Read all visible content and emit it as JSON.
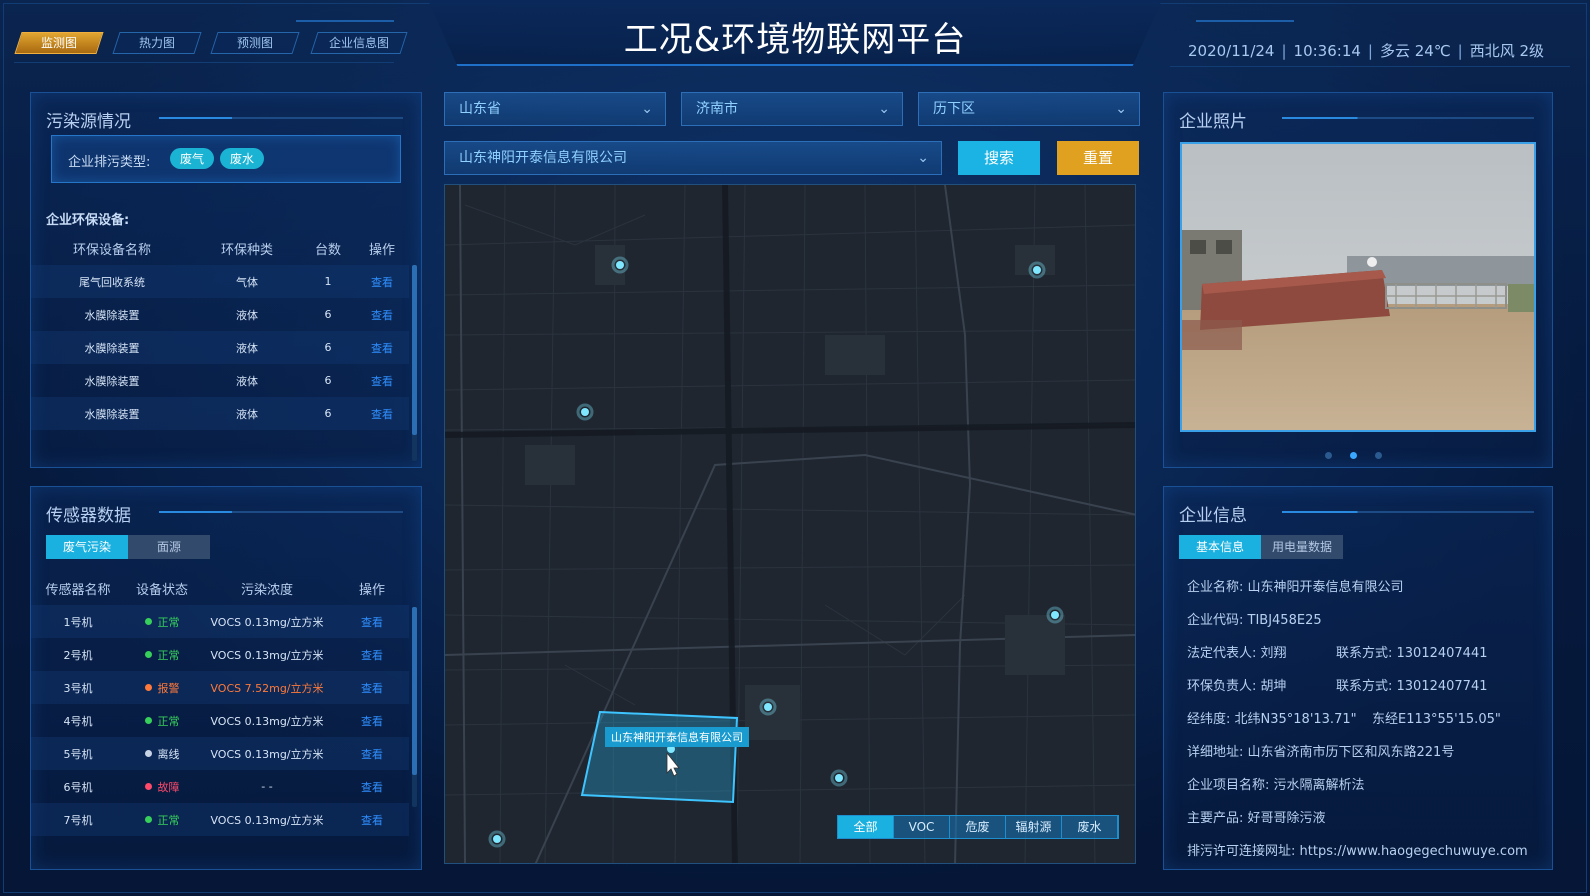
{
  "header": {
    "title": "工况&环境物联网平台",
    "tabs": [
      "监测图",
      "热力图",
      "预测图",
      "企业信息图"
    ],
    "active_tab": 0,
    "date": "2020/11/24",
    "time": "10:36:14",
    "weather": "多云 24℃",
    "wind": "西北风 2级"
  },
  "pollution": {
    "title": "污染源情况",
    "type_label": "企业排污类型:",
    "types": [
      "废气",
      "废水"
    ],
    "equipment_label": "企业环保设备:",
    "columns": [
      "环保设备名称",
      "环保种类",
      "台数",
      "操作"
    ],
    "rows": [
      [
        "尾气回收系统",
        "气体",
        "1",
        "查看"
      ],
      [
        "水膜除装置",
        "液体",
        "6",
        "查看"
      ],
      [
        "水膜除装置",
        "液体",
        "6",
        "查看"
      ],
      [
        "水膜除装置",
        "液体",
        "6",
        "查看"
      ],
      [
        "水膜除装置",
        "液体",
        "6",
        "查看"
      ]
    ]
  },
  "sensor": {
    "title": "传感器数据",
    "tabs": [
      "废气污染",
      "面源"
    ],
    "columns": [
      "传感器名称",
      "设备状态",
      "污染浓度",
      "操作"
    ],
    "rows": [
      {
        "name": "1号机",
        "status": "正常",
        "status_color": "#37d05a",
        "dot_color": "#37d05a",
        "conc": "VOCS  0.13mg/立方米",
        "conc_color": "#d6e4f6",
        "op": "查看"
      },
      {
        "name": "2号机",
        "status": "正常",
        "status_color": "#37d05a",
        "dot_color": "#37d05a",
        "conc": "VOCS  0.13mg/立方米",
        "conc_color": "#d6e4f6",
        "op": "查看"
      },
      {
        "name": "3号机",
        "status": "报警",
        "status_color": "#ff7a3a",
        "dot_color": "#ff7a3a",
        "conc": "VOCS  7.52mg/立方米",
        "conc_color": "#ff7a3a",
        "op": "查看"
      },
      {
        "name": "4号机",
        "status": "正常",
        "status_color": "#37d05a",
        "dot_color": "#37d05a",
        "conc": "VOCS  0.13mg/立方米",
        "conc_color": "#d6e4f6",
        "op": "查看"
      },
      {
        "name": "5号机",
        "status": "离线",
        "status_color": "#d6e4f6",
        "dot_color": "#c9d3e6",
        "conc": "VOCS  0.13mg/立方米",
        "conc_color": "#d6e4f6",
        "op": "查看"
      },
      {
        "name": "6号机",
        "status": "故障",
        "status_color": "#ff4a6a",
        "dot_color": "#ff4a6a",
        "conc": "- -",
        "conc_color": "#d6e4f6",
        "op": "查看"
      },
      {
        "name": "7号机",
        "status": "正常",
        "status_color": "#37d05a",
        "dot_color": "#37d05a",
        "conc": "VOCS  0.13mg/立方米",
        "conc_color": "#d6e4f6",
        "op": "查看"
      }
    ]
  },
  "filters": {
    "province": "山东省",
    "city": "济南市",
    "district": "历下区",
    "company": "山东神阳开泰信息有限公司",
    "search_label": "搜索",
    "reset_label": "重置"
  },
  "map": {
    "selected_label": "山东神阳开泰信息有限公司",
    "legend": [
      "全部",
      "VOC",
      "危废",
      "辐射源",
      "废水"
    ],
    "legend_active": 0
  },
  "photo": {
    "title": "企业照片",
    "dots": 3,
    "active_dot": 1
  },
  "company": {
    "title": "企业信息",
    "tabs": [
      "基本信息",
      "用电量数据"
    ],
    "name": "企业名称: 山东神阳开泰信息有限公司",
    "code": "企业代码: TIBJ458E25",
    "legal_rep": "法定代表人: 刘翔",
    "legal_contact": "联系方式: 13012407441",
    "env_rep": "环保负责人: 胡坤",
    "env_contact": "联系方式: 13012407741",
    "lat": "经纬度: 北纬N35°18'13.71\"",
    "lon": "东经E113°55'15.05\"",
    "address": "详细地址: 山东省济南市历下区和风东路221号",
    "project": "企业项目名称: 污水隔离解析法",
    "product": "主要产品: 好哥哥除污液",
    "url": "排污许可连接网址: https://www.haogegechuwuye.com"
  }
}
